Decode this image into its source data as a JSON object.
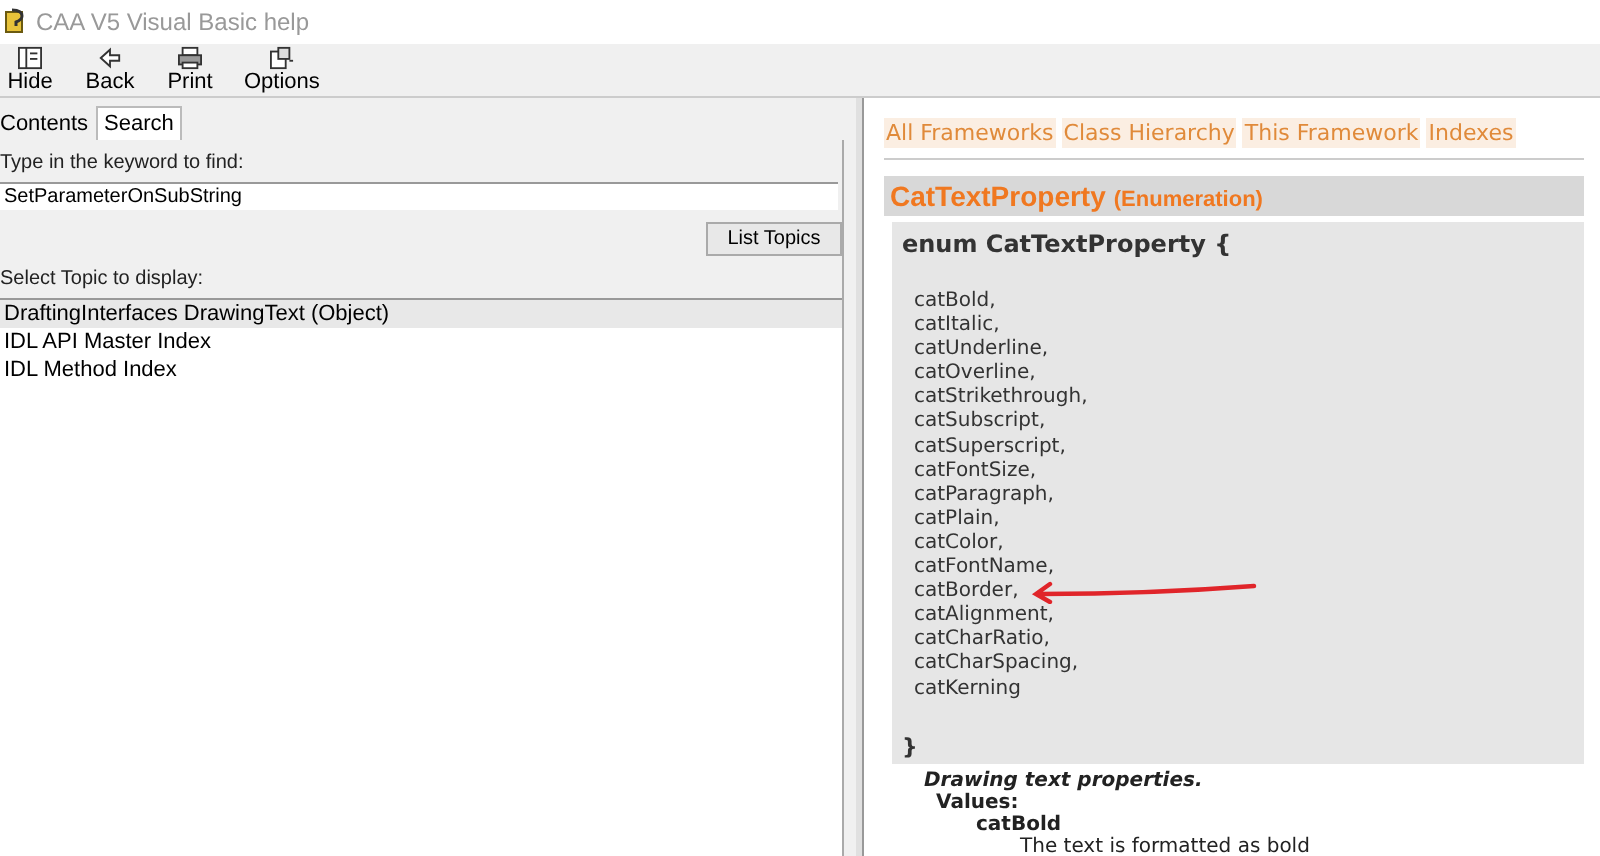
{
  "window": {
    "title": "CAA V5 Visual Basic help"
  },
  "toolbar": [
    {
      "label": "Hide",
      "kind": "hide"
    },
    {
      "label": "Back",
      "kind": "back"
    },
    {
      "label": "Print",
      "kind": "print"
    },
    {
      "label": "Options",
      "kind": "options"
    }
  ],
  "tabs": [
    {
      "label": "Contents",
      "selected": false
    },
    {
      "label": "Search",
      "selected": true
    }
  ],
  "search": {
    "prompt": "Type in the keyword to find:",
    "value": "SetParameterOnSubString",
    "button": "List Topics",
    "list_label": "Select Topic to display:"
  },
  "topics": [
    {
      "label": "DraftingInterfaces DrawingText (Object)",
      "selected": true
    },
    {
      "label": "IDL API Master Index",
      "selected": false
    },
    {
      "label": "IDL Method Index",
      "selected": false
    }
  ],
  "nav_links": [
    "All Frameworks",
    "Class Hierarchy",
    "This Framework",
    "Indexes"
  ],
  "heading": {
    "name": "CatTextProperty",
    "kind": "(Enumeration)"
  },
  "code": {
    "opening": "enum CatTextProperty {",
    "members": [
      {
        "text": "catBold,",
        "arrow": false
      },
      {
        "text": "catItalic,",
        "arrow": false
      },
      {
        "text": "catUnderline,",
        "arrow": false
      },
      {
        "text": "catOverline,",
        "arrow": false
      },
      {
        "text": "catStrikethrough,",
        "arrow": false
      },
      {
        "text": "catSubscript,",
        "arrow": false
      },
      {
        "text": "catSuperscript,",
        "arrow": false
      },
      {
        "text": "catFontSize,",
        "arrow": false
      },
      {
        "text": "catParagraph,",
        "arrow": false
      },
      {
        "text": "catPlain,",
        "arrow": false
      },
      {
        "text": "catColor,",
        "arrow": false
      },
      {
        "text": "catFontName,",
        "arrow": false
      },
      {
        "text": "catBorder,",
        "arrow": true
      },
      {
        "text": "catAlignment,",
        "arrow": false
      },
      {
        "text": "catCharRatio,",
        "arrow": false
      },
      {
        "text": "catCharSpacing,",
        "arrow": false
      },
      {
        "text": "catKerning",
        "arrow": false
      }
    ],
    "closing": "}"
  },
  "description": {
    "summary": "Drawing text properties.",
    "values_label": "Values:",
    "first_value": "catBold",
    "first_value_text": "The text is formatted as bold"
  }
}
